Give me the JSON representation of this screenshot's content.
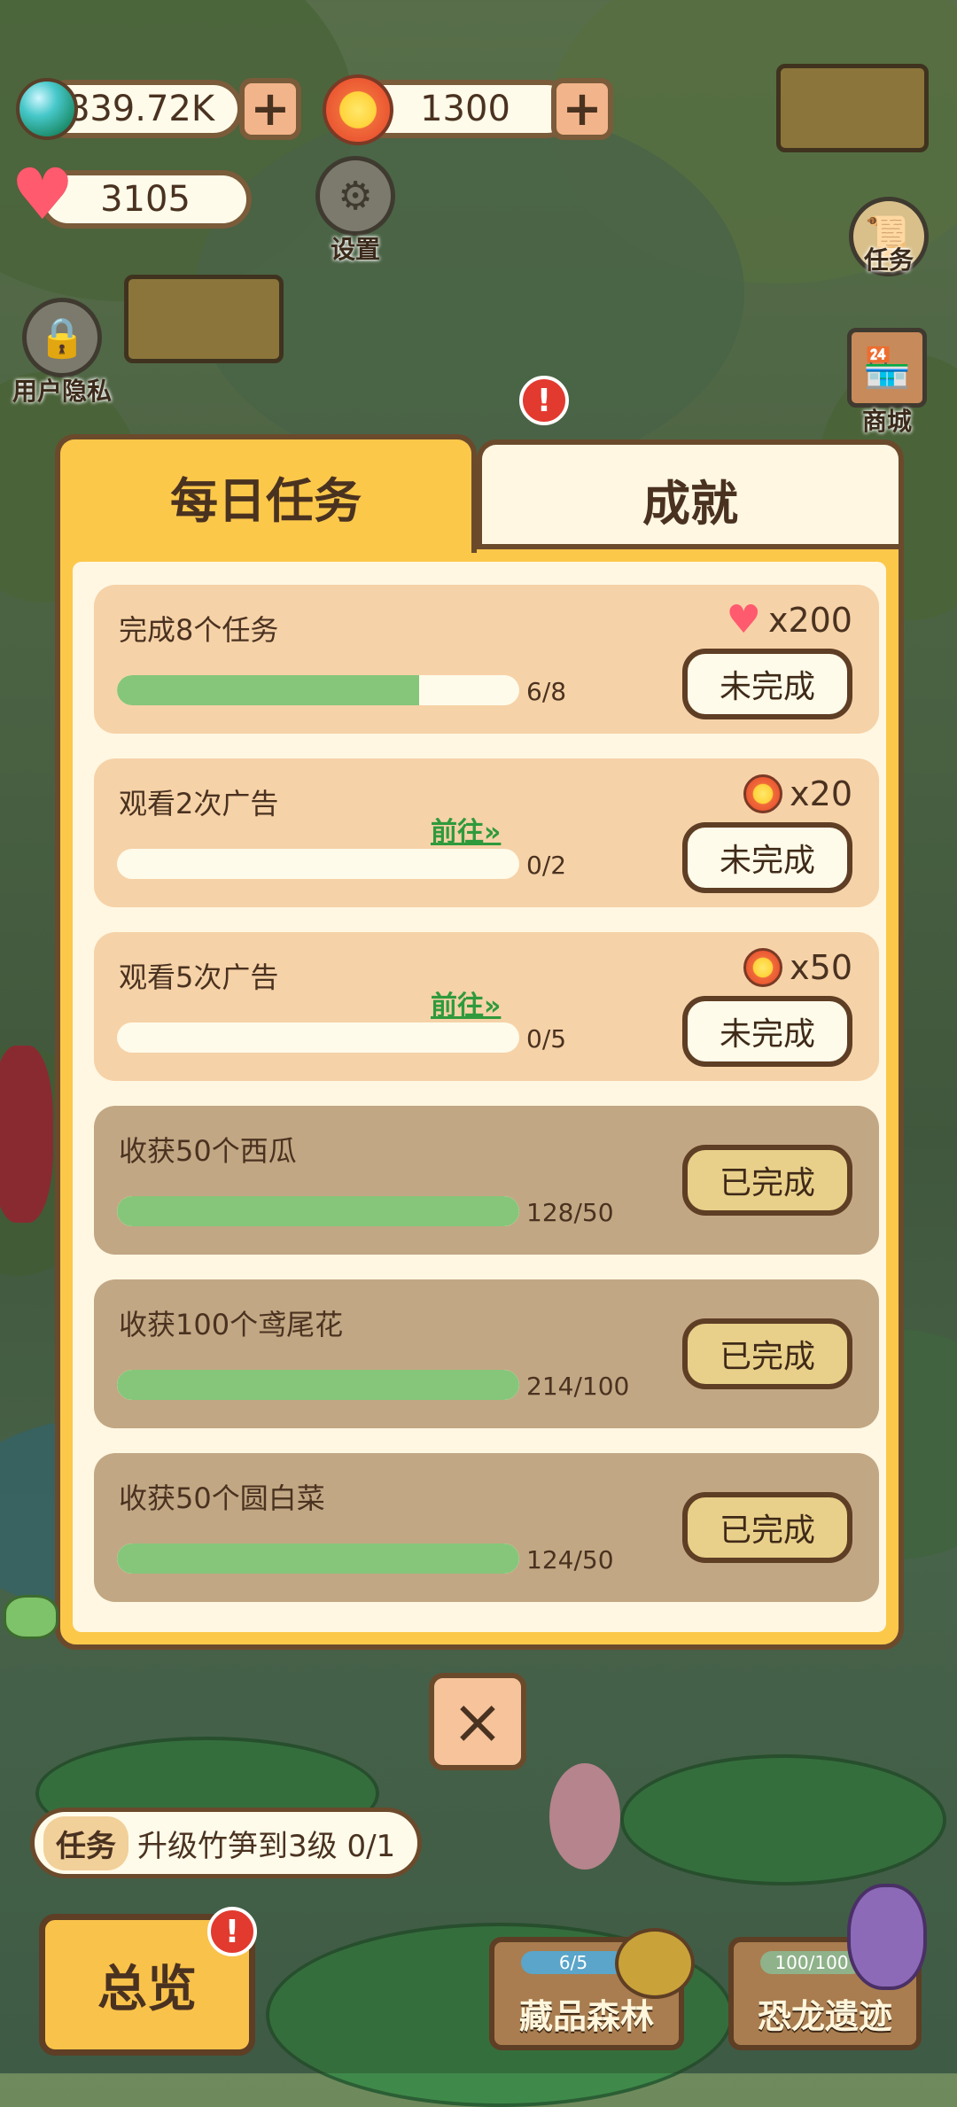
{
  "top": {
    "gems": "839.72K",
    "suns": "1300",
    "hearts": "3105",
    "settings_label": "设置",
    "privacy_label": "用户隐私",
    "tasks_label": "任务",
    "shop_label": "商城",
    "alert_mark": "!"
  },
  "modal": {
    "tabs": [
      {
        "label": "每日任务",
        "active": true
      },
      {
        "label": "成就",
        "active": false
      }
    ],
    "tasks": [
      {
        "name": "完成8个任务",
        "progress_text": "6/8",
        "progress": 0.75,
        "reward_icon": "heart-icon",
        "reward": "x200",
        "status": "未完成",
        "done": false,
        "goto": ""
      },
      {
        "name": "观看2次广告",
        "progress_text": "0/2",
        "progress": 0.0,
        "reward_icon": "sun-icon",
        "reward": "x20",
        "status": "未完成",
        "done": false,
        "goto": "前往»"
      },
      {
        "name": "观看5次广告",
        "progress_text": "0/5",
        "progress": 0.0,
        "reward_icon": "sun-icon",
        "reward": "x50",
        "status": "未完成",
        "done": false,
        "goto": "前往»"
      },
      {
        "name": "收获50个西瓜",
        "progress_text": "128/50",
        "progress": 1.0,
        "status": "已完成",
        "done": true
      },
      {
        "name": "收获100个鸢尾花",
        "progress_text": "214/100",
        "progress": 1.0,
        "status": "已完成",
        "done": true
      },
      {
        "name": "收获50个圆白菜",
        "progress_text": "124/50",
        "progress": 1.0,
        "status": "已完成",
        "done": true
      }
    ],
    "close_icon": "×"
  },
  "bottom": {
    "mission_tag": "任务",
    "mission_text": "升级竹笋到3级 0/1",
    "overview_label": "总览",
    "overview_badge": "!",
    "collection": {
      "label": "藏品森林",
      "progress_text": "6/5",
      "progress": 1.0
    },
    "dino": {
      "label": "恐龙遗迹",
      "progress_text": "100/100",
      "progress": 1.0
    }
  },
  "colors": {
    "accent": "#fcc84a",
    "panel": "#fff7e2",
    "progress": "#86c67a",
    "link": "#2f9a3c",
    "border": "#6b4a2c"
  }
}
